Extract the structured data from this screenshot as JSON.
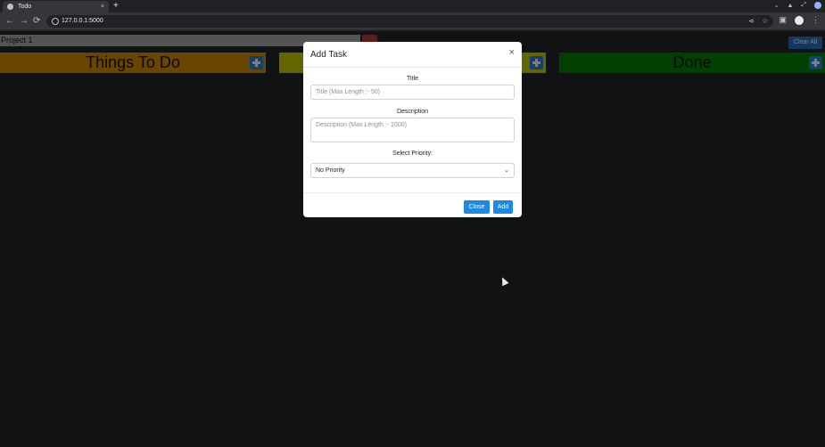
{
  "browser": {
    "tab_title": "Todo",
    "tab_close": "×",
    "new_tab": "+",
    "url": "127.0.0.1:5000",
    "icons": [
      "back-icon",
      "forward-icon",
      "reload-icon",
      "info-icon",
      "share-icon",
      "star-icon",
      "sidepanel-icon",
      "profile-icon",
      "menu-icon"
    ]
  },
  "nav": {
    "back": "←",
    "forward": "→",
    "reload": "⟳",
    "share": "⋖",
    "star": "☆",
    "sidepanel": "▣",
    "menu": "⋮"
  },
  "page": {
    "project_name": "Project 1",
    "clear_all_label": "Clear All",
    "columns": [
      {
        "title": "Things To Do",
        "color": "#d58a00"
      },
      {
        "title": "",
        "color": "#c9c900"
      },
      {
        "title": "Done",
        "color": "#008000"
      }
    ]
  },
  "modal": {
    "title": "Add Task",
    "close_symbol": "×",
    "title_label": "Title",
    "title_placeholder": "Title (Max Length :- 50)",
    "description_label": "Description",
    "description_placeholder": "Description (Max Length :- 1000)",
    "priority_label": "Select Priority:",
    "priority_selected": "No Priority",
    "close_button": "Close",
    "add_button": "Add"
  },
  "colors": {
    "page_bg": "#212529",
    "accent": "#1e88e5"
  }
}
